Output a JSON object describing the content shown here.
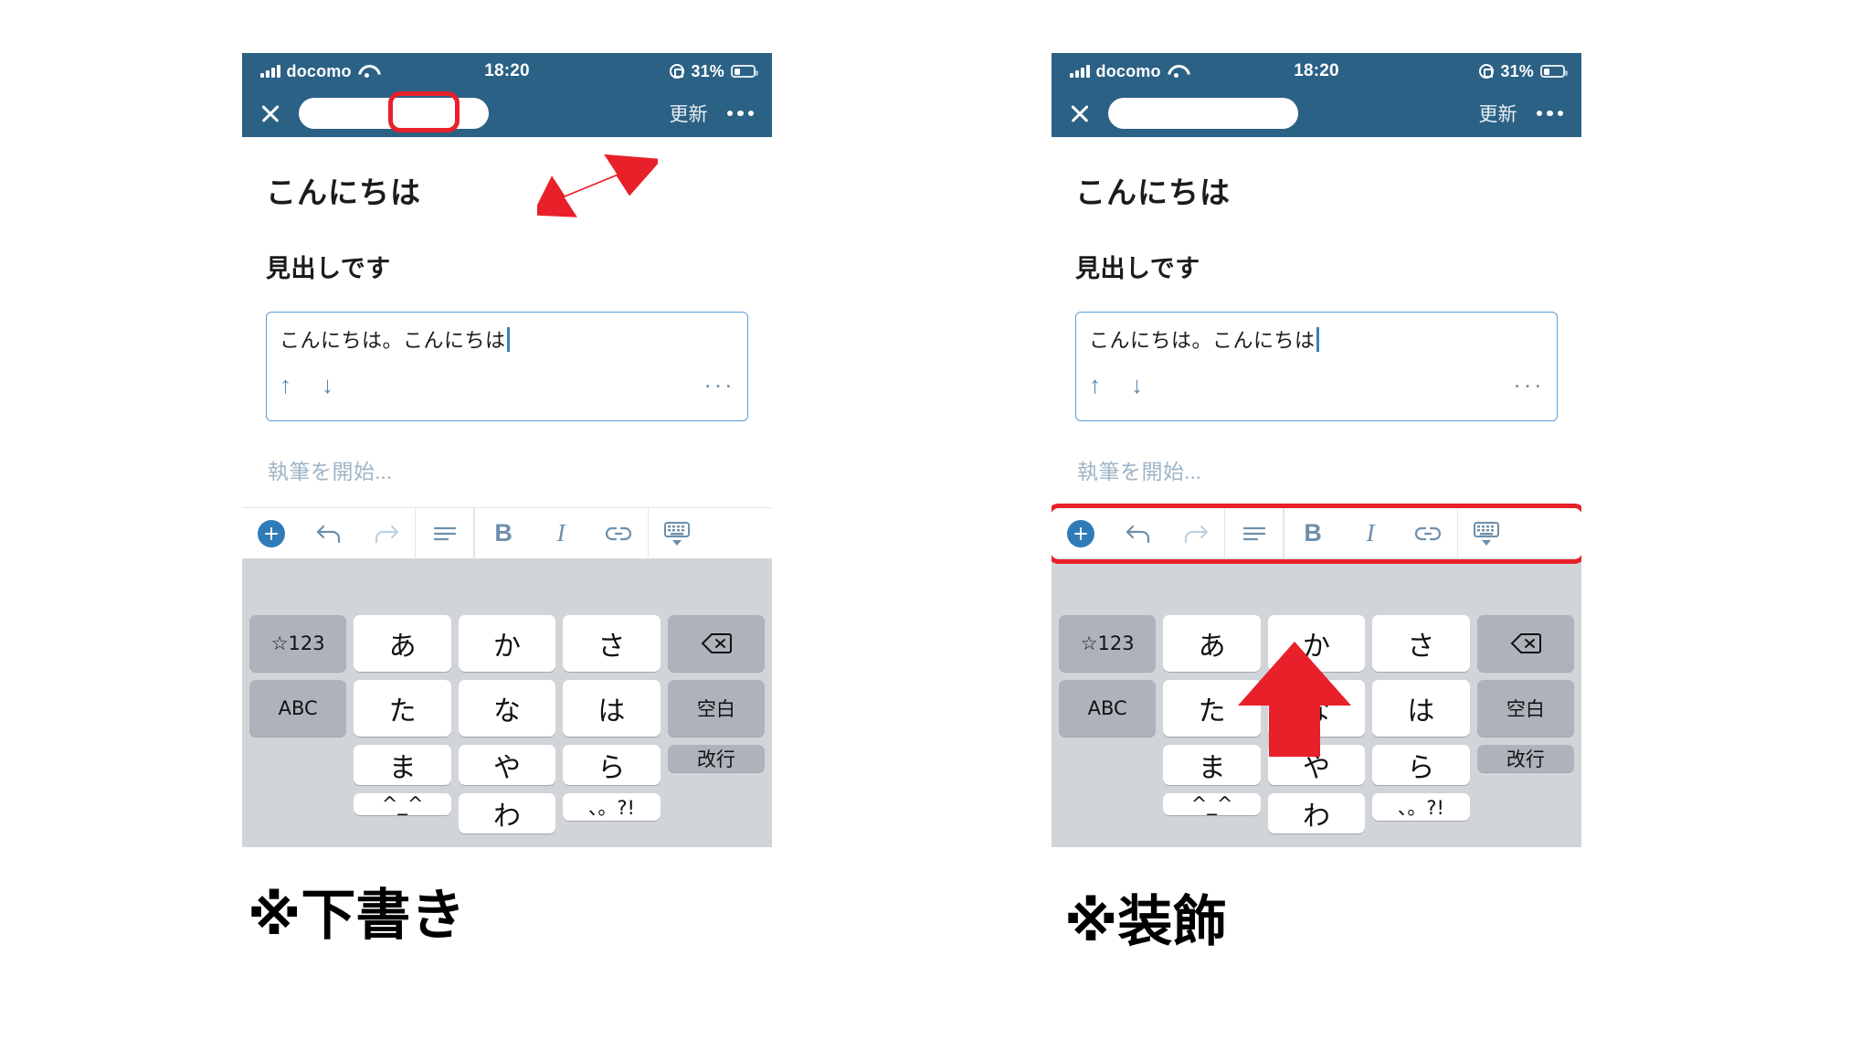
{
  "meta": {
    "accent_red": "#e8202a",
    "navbar_blue": "#2b6185",
    "editor_blue": "#2f7cb8",
    "keyboard_bg": "#d1d5da"
  },
  "panels": [
    {
      "id": "left",
      "status": {
        "carrier": "docomo",
        "time": "18:20",
        "battery_percent": "31%",
        "signal_icon": "cellular-signal-icon",
        "wifi_icon": "wifi-icon",
        "rotation_lock_icon": "rotation-lock-icon",
        "battery_icon": "battery-icon"
      },
      "navbar": {
        "close_icon": "close-icon",
        "title_pill": "",
        "update_label": "更新",
        "more_icon": "more-options-icon",
        "update_highlighted": true
      },
      "document": {
        "title": "こんにちは",
        "heading": "見出しです",
        "block_text": "こんにちは。こんにちは",
        "move_up_icon": "↑",
        "move_down_icon": "↓",
        "block_more_icon": "···",
        "placeholder": "執筆を開始..."
      },
      "toolbar": {
        "highlighted": false,
        "items": [
          {
            "name": "add-block-button",
            "label": ""
          },
          {
            "name": "undo-button",
            "label": "↩"
          },
          {
            "name": "redo-button",
            "label": "↪"
          },
          {
            "name": "paragraph-style-button",
            "label": ""
          },
          {
            "name": "bold-button",
            "label": "B"
          },
          {
            "name": "italic-button",
            "label": "I"
          },
          {
            "name": "link-button",
            "label": "(-)"
          },
          {
            "name": "dismiss-keyboard-button",
            "label": ""
          }
        ]
      },
      "keyboard": {
        "row1": [
          "☆123",
          "あ",
          "か",
          "さ",
          "delete"
        ],
        "row2": [
          "ABC",
          "た",
          "な",
          "は",
          "空白"
        ],
        "row3": [
          "☺",
          "ま",
          "や",
          "ら",
          "改行"
        ],
        "row4": [
          "🌐",
          "^_^",
          "わ",
          "、。?!",
          ""
        ]
      },
      "annotation": {
        "overlay_label": "※下書き",
        "arrow": "diagonal-up-right-arrow"
      }
    },
    {
      "id": "right",
      "status": {
        "carrier": "docomo",
        "time": "18:20",
        "battery_percent": "31%",
        "signal_icon": "cellular-signal-icon",
        "wifi_icon": "wifi-icon",
        "rotation_lock_icon": "rotation-lock-icon",
        "battery_icon": "battery-icon"
      },
      "navbar": {
        "close_icon": "close-icon",
        "title_pill": "",
        "update_label": "更新",
        "more_icon": "more-options-icon",
        "update_highlighted": false
      },
      "document": {
        "title": "こんにちは",
        "heading": "見出しです",
        "block_text": "こんにちは。こんにちは",
        "move_up_icon": "↑",
        "move_down_icon": "↓",
        "block_more_icon": "···",
        "placeholder": "執筆を開始..."
      },
      "toolbar": {
        "highlighted": true,
        "items": [
          {
            "name": "add-block-button",
            "label": ""
          },
          {
            "name": "undo-button",
            "label": "↩"
          },
          {
            "name": "redo-button",
            "label": "↪"
          },
          {
            "name": "paragraph-style-button",
            "label": ""
          },
          {
            "name": "bold-button",
            "label": "B"
          },
          {
            "name": "italic-button",
            "label": "I"
          },
          {
            "name": "link-button",
            "label": "(-)"
          },
          {
            "name": "dismiss-keyboard-button",
            "label": ""
          }
        ]
      },
      "keyboard": {
        "row1": [
          "☆123",
          "あ",
          "か",
          "さ",
          "delete"
        ],
        "row2": [
          "ABC",
          "た",
          "な",
          "は",
          "空白"
        ],
        "row3": [
          "☺",
          "ま",
          "や",
          "ら",
          "改行"
        ],
        "row4": [
          "🌐",
          "^_^",
          "わ",
          "、。?!",
          ""
        ]
      },
      "annotation": {
        "overlay_label": "※装飾",
        "arrow": "up-arrow"
      }
    }
  ]
}
